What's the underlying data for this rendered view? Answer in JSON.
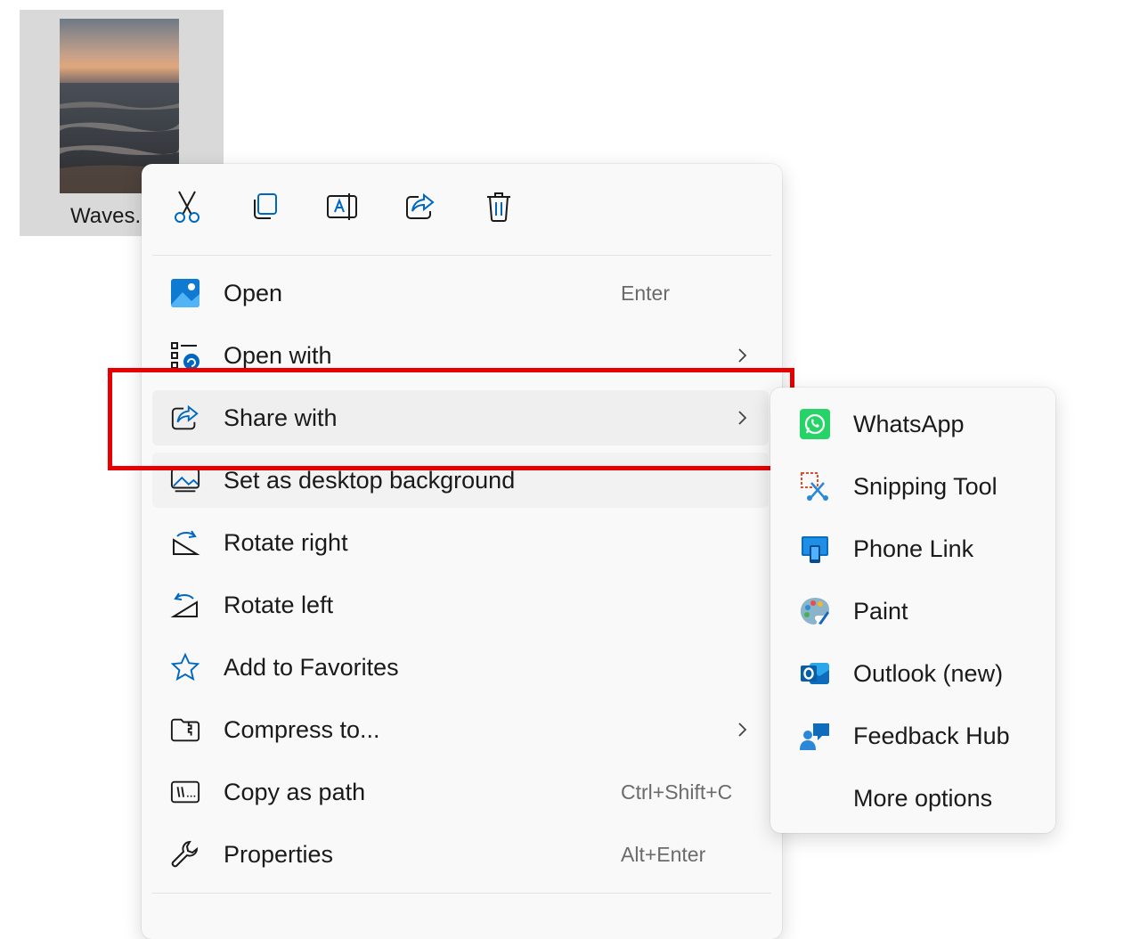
{
  "file": {
    "name": "Waves.",
    "thumbnail_icon": "sunset-waves-photo"
  },
  "quick_actions": [
    {
      "name": "cut",
      "icon": "scissors-icon"
    },
    {
      "name": "copy",
      "icon": "copy-icon"
    },
    {
      "name": "rename",
      "icon": "rename-icon"
    },
    {
      "name": "share",
      "icon": "share-icon"
    },
    {
      "name": "delete",
      "icon": "trash-icon"
    }
  ],
  "menu": {
    "items": [
      {
        "label": "Open",
        "shortcut": "Enter",
        "icon": "photos-app-icon"
      },
      {
        "label": "Open with",
        "shortcut": "",
        "icon": "open-with-icon",
        "submenu": true
      },
      {
        "label": "Share with",
        "shortcut": "",
        "icon": "share-icon",
        "submenu": true,
        "state": "hovered"
      },
      {
        "label": "Set as desktop background",
        "shortcut": "",
        "icon": "desktop-background-icon"
      },
      {
        "label": "Rotate right",
        "shortcut": "",
        "icon": "rotate-right-icon"
      },
      {
        "label": "Rotate left",
        "shortcut": "",
        "icon": "rotate-left-icon"
      },
      {
        "label": "Add to Favorites",
        "shortcut": "",
        "icon": "star-icon"
      },
      {
        "label": "Compress to...",
        "shortcut": "",
        "icon": "zip-folder-icon",
        "submenu": true
      },
      {
        "label": "Copy as path",
        "shortcut": "Ctrl+Shift+C",
        "icon": "copy-path-icon"
      },
      {
        "label": "Properties",
        "shortcut": "Alt+Enter",
        "icon": "wrench-icon"
      }
    ]
  },
  "share_submenu": {
    "items": [
      {
        "label": "WhatsApp",
        "icon": "whatsapp-icon"
      },
      {
        "label": "Snipping Tool",
        "icon": "snipping-tool-icon"
      },
      {
        "label": "Phone Link",
        "icon": "phone-link-icon"
      },
      {
        "label": "Paint",
        "icon": "paint-icon"
      },
      {
        "label": "Outlook (new)",
        "icon": "outlook-icon"
      },
      {
        "label": "Feedback Hub",
        "icon": "feedback-hub-icon"
      },
      {
        "label": "More options",
        "icon": ""
      }
    ]
  },
  "colors": {
    "accent": "#0067c0",
    "highlight_box": "#e60000",
    "menu_background": "#f9f9f9",
    "hover": "#efefef",
    "whatsapp": "#25d366",
    "outlook": "#0f6cbd"
  }
}
